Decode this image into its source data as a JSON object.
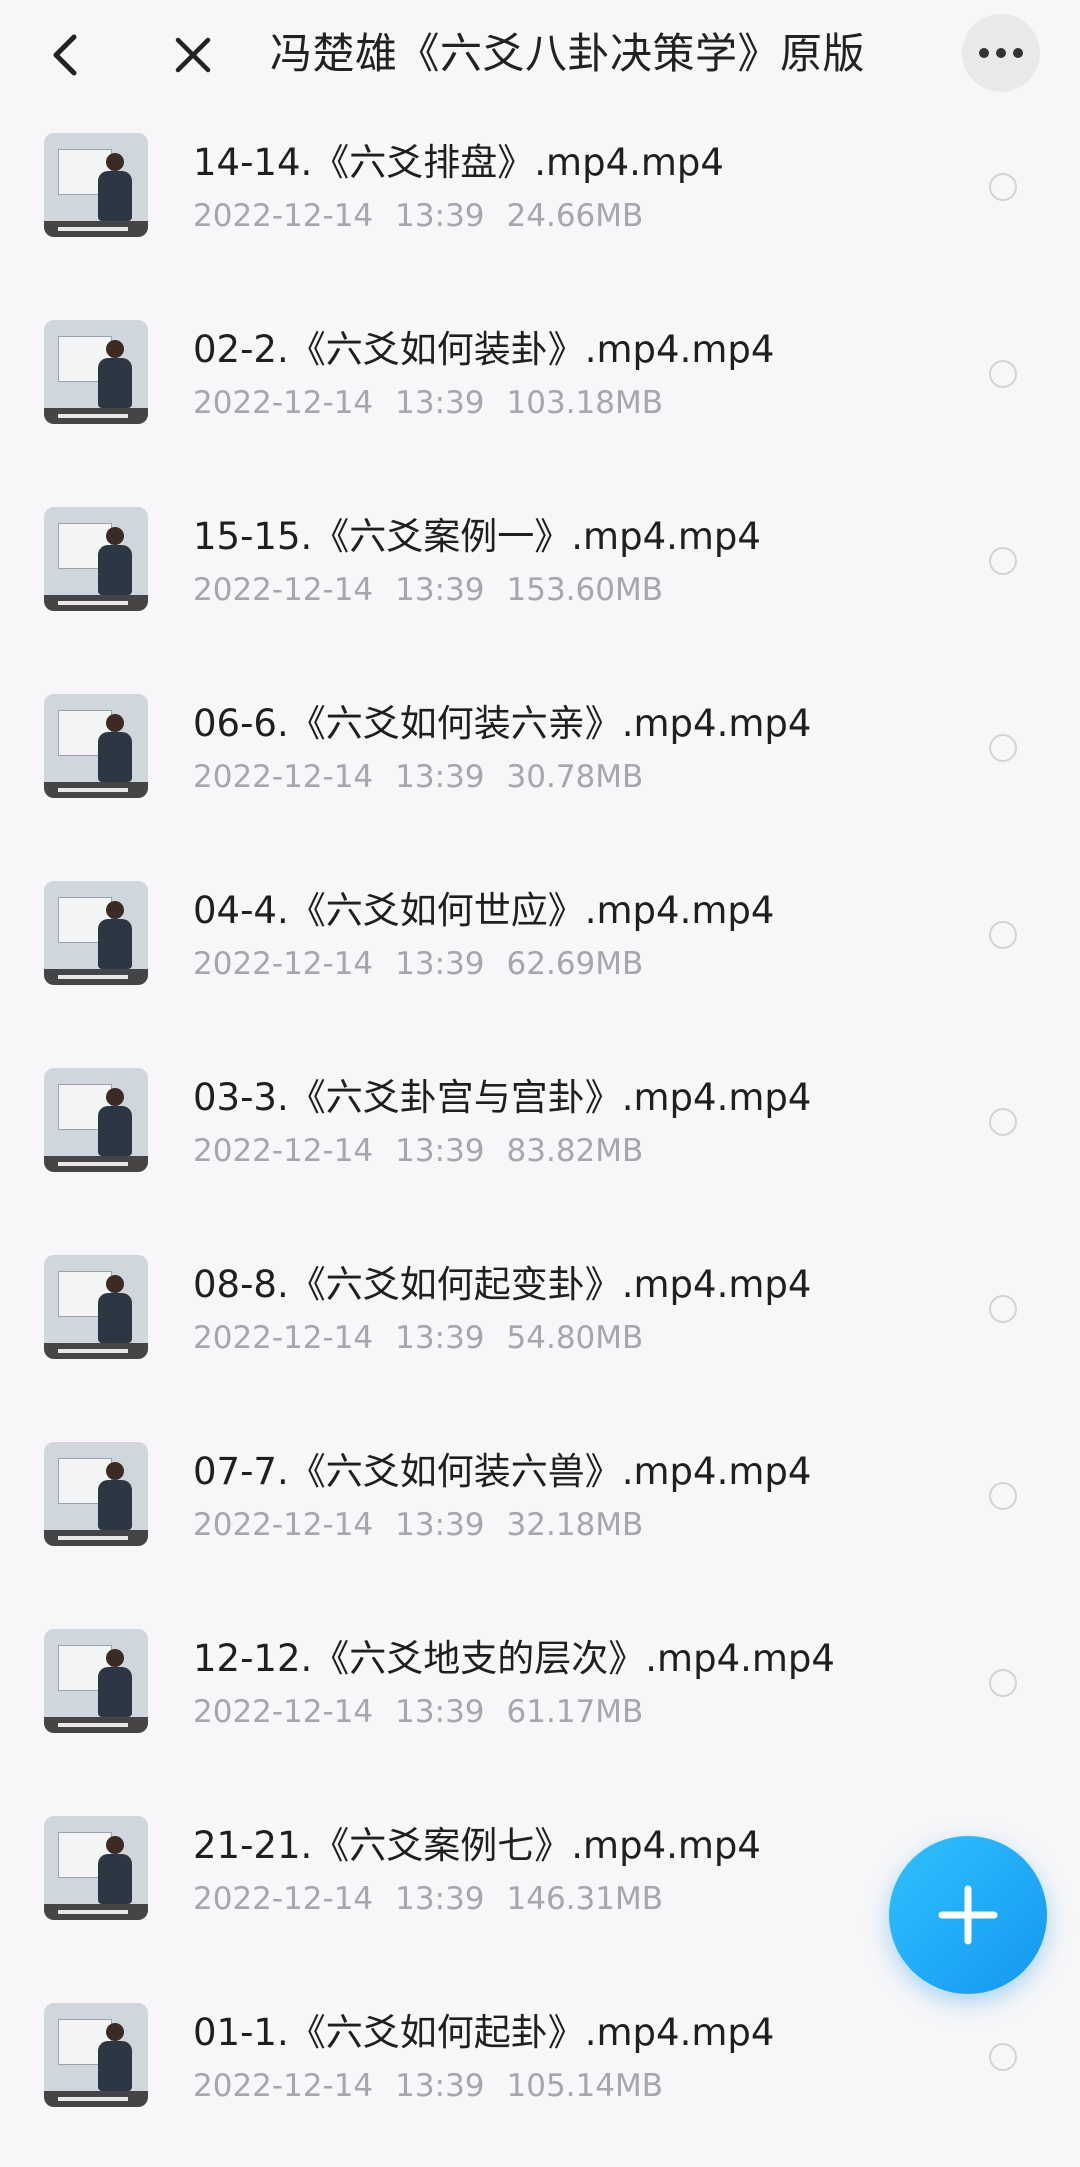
{
  "header": {
    "title": "冯楚雄《六爻八卦决策学》原版",
    "icons": {
      "back": "chevron-left-icon",
      "close": "close-icon",
      "more": "more-horizontal-icon"
    }
  },
  "files": [
    {
      "name": "14-14.《六爻排盘》.mp4.mp4",
      "date": "2022-12-14",
      "time": "13:39",
      "size": "24.66MB"
    },
    {
      "name": "02-2.《六爻如何装卦》.mp4.mp4",
      "date": "2022-12-14",
      "time": "13:39",
      "size": "103.18MB"
    },
    {
      "name": "15-15.《六爻案例一》.mp4.mp4",
      "date": "2022-12-14",
      "time": "13:39",
      "size": "153.60MB"
    },
    {
      "name": "06-6.《六爻如何装六亲》.mp4.mp4",
      "date": "2022-12-14",
      "time": "13:39",
      "size": "30.78MB"
    },
    {
      "name": "04-4.《六爻如何世应》.mp4.mp4",
      "date": "2022-12-14",
      "time": "13:39",
      "size": "62.69MB"
    },
    {
      "name": "03-3.《六爻卦宫与宫卦》.mp4.mp4",
      "date": "2022-12-14",
      "time": "13:39",
      "size": "83.82MB"
    },
    {
      "name": "08-8.《六爻如何起变卦》.mp4.mp4",
      "date": "2022-12-14",
      "time": "13:39",
      "size": "54.80MB"
    },
    {
      "name": "07-7.《六爻如何装六兽》.mp4.mp4",
      "date": "2022-12-14",
      "time": "13:39",
      "size": "32.18MB"
    },
    {
      "name": "12-12.《六爻地支的层次》.mp4.mp4",
      "date": "2022-12-14",
      "time": "13:39",
      "size": "61.17MB"
    },
    {
      "name": "21-21.《六爻案例七》.mp4.mp4",
      "date": "2022-12-14",
      "time": "13:39",
      "size": "146.31MB"
    },
    {
      "name": "01-1.《六爻如何起卦》.mp4.mp4",
      "date": "2022-12-14",
      "time": "13:39",
      "size": "105.14MB"
    }
  ],
  "fab": {
    "icon": "plus-icon"
  },
  "colors": {
    "accent": "#1aa7f5",
    "background": "#f7f7f9",
    "meta_text": "#a7a7ab"
  }
}
